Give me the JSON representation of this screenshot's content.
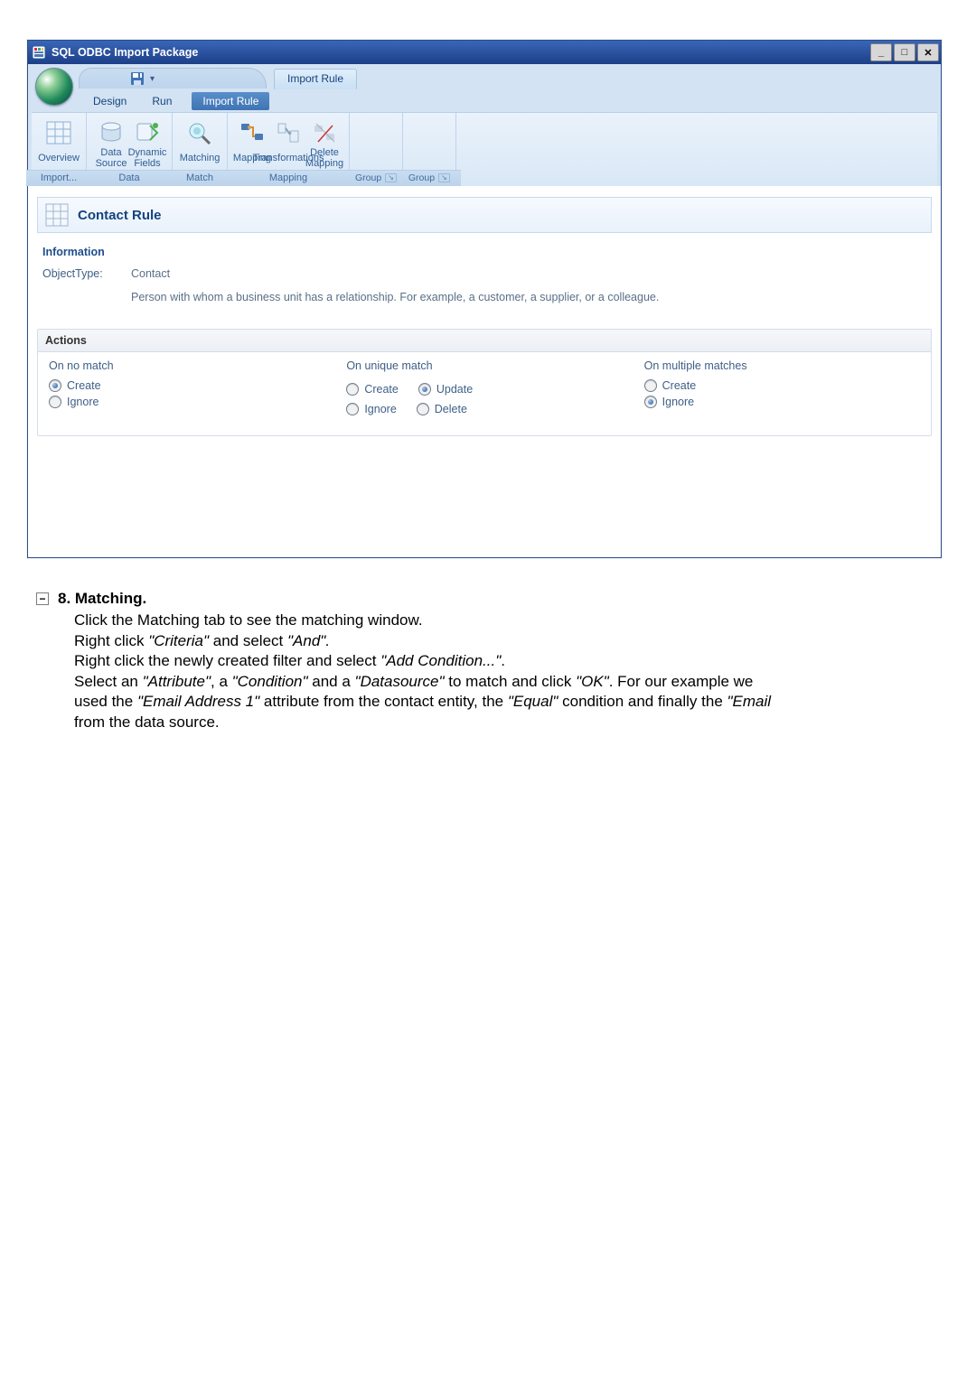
{
  "window": {
    "title": "SQL ODBC Import Package"
  },
  "ribbon": {
    "top_tab": "Import Rule",
    "sub_tabs": {
      "design": "Design",
      "run": "Run",
      "pill": "Import Rule"
    },
    "groups": {
      "import": {
        "overview": "Overview",
        "caption": "Import..."
      },
      "data": {
        "datasource": "Data Source",
        "dynamic": "Dynamic\nFields",
        "caption": "Data"
      },
      "match": {
        "matching": "Matching",
        "caption": "Match"
      },
      "mapping": {
        "mapping": "Mapping",
        "transformations": "Transformations",
        "delmap": "Delete\nMapping",
        "caption": "Mapping"
      },
      "group1": {
        "caption": "Group"
      },
      "group2": {
        "caption": "Group"
      }
    }
  },
  "rule": {
    "title": "Contact Rule",
    "info_title": "Information",
    "object_type_label": "ObjectType:",
    "object_type_value": "Contact",
    "description": "Person with whom a business unit has a relationship. For example, a customer, a supplier, or a colleague."
  },
  "actions": {
    "title": "Actions",
    "nomatch": {
      "title": "On no match",
      "create": "Create",
      "ignore": "Ignore"
    },
    "unique": {
      "title": "On unique match",
      "create": "Create",
      "update": "Update",
      "ignore": "Ignore",
      "delete": "Delete"
    },
    "multiple": {
      "title": "On multiple matches",
      "create": "Create",
      "ignore": "Ignore"
    }
  },
  "step": {
    "number_title": "8.  Matching.",
    "l1": "Click the Matching tab to  see the matching window.",
    "l2a": "Right click ",
    "l2b": "\"Criteria\"",
    "l2c": " and select ",
    "l2d": "\"And\".",
    "l3a": "Right click the newly created filter and select ",
    "l3b": "\"Add Condition...\"",
    "l3c": ".",
    "l4a": "Select an ",
    "l4b": "\"Attribute\"",
    "l4c": ", a ",
    "l4d": "\"Condition\"",
    "l4e": " and a ",
    "l4f": "\"Datasource\"",
    "l4g": " to match and click ",
    "l4h": "\"OK\"",
    "l4i": ".  For our example we",
    "l5a": "used the ",
    "l5b": "\"Email Address 1\"",
    "l5c": " attribute from the contact entity, the ",
    "l5d": "\"Equal\"",
    "l5e": " condition and finally the ",
    "l5f": "\"Email",
    "l6": "from the data source."
  }
}
